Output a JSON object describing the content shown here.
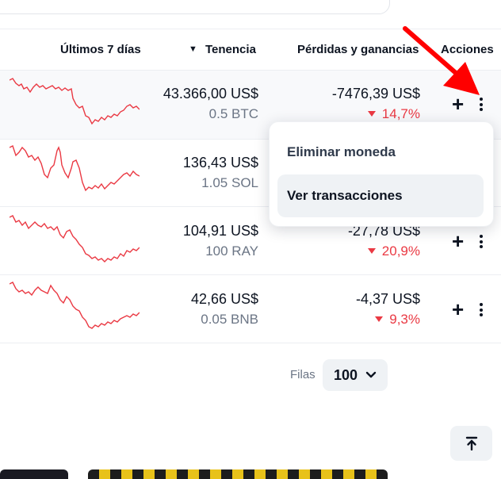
{
  "table": {
    "headers": {
      "last7": "Últimos 7 días",
      "holdings": "Tenencia",
      "pnl": "Pérdidas y ganancias",
      "actions": "Acciones"
    },
    "sort_indicator": "▼",
    "rows": [
      {
        "value": "43.366,00 US$",
        "amount": "0.5 BTC",
        "pnl": "-7476,39 US$",
        "pnl_pct": "14,7%"
      },
      {
        "value": "136,43 US$",
        "amount": "1.05 SOL",
        "pnl": "",
        "pnl_pct": ""
      },
      {
        "value": "104,91 US$",
        "amount": "100 RAY",
        "pnl": "-27,78 US$",
        "pnl_pct": "20,9%"
      },
      {
        "value": "42,66 US$",
        "amount": "0.05 BNB",
        "pnl": "-4,37 US$",
        "pnl_pct": "9,3%"
      }
    ]
  },
  "menu": {
    "items": [
      {
        "label": "Eliminar moneda"
      },
      {
        "label": "Ver transacciones"
      }
    ]
  },
  "pagination": {
    "rows_label": "Filas",
    "rows_value": "100"
  },
  "icons": {
    "add": "plus-icon",
    "more": "kebab-icon",
    "chevron": "chevron-down-icon",
    "back_to_top": "arrow-up-icon"
  },
  "colors": {
    "negative": "#ea3943",
    "annotation_arrow": "#ff0000",
    "menu_active_bg": "#eff2f5"
  }
}
